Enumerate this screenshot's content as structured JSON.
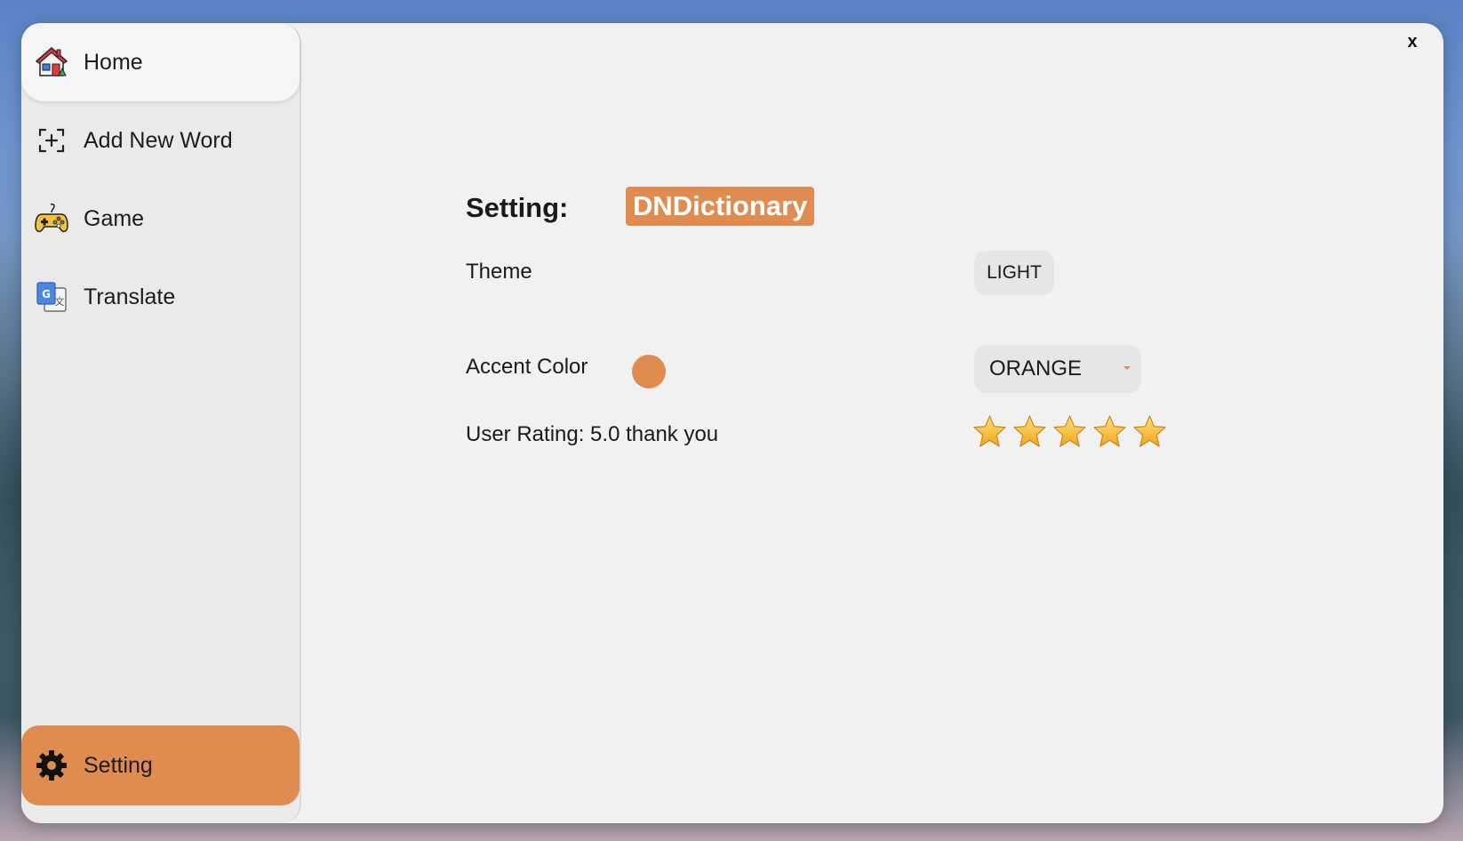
{
  "sidebar": {
    "items": [
      {
        "label": "Home",
        "icon": "home-icon"
      },
      {
        "label": "Add New Word",
        "icon": "add-word-icon"
      },
      {
        "label": "Game",
        "icon": "gamepad-icon"
      },
      {
        "label": "Translate",
        "icon": "translate-icon"
      }
    ],
    "setting": {
      "label": "Setting",
      "icon": "gear-icon"
    }
  },
  "window": {
    "close_label": "x"
  },
  "settings": {
    "title": "Setting:",
    "app_name": "DNDictionary",
    "theme": {
      "label": "Theme",
      "value": "LIGHT"
    },
    "accent": {
      "label": "Accent Color",
      "value": "ORANGE",
      "color": "#e08c50"
    },
    "rating": {
      "label": "User Rating: 5.0 thank you",
      "stars": 5,
      "max_stars": 5
    }
  },
  "colors": {
    "accent": "#e08c50",
    "panel": "#f1f1f1",
    "sidebar": "#eaeaea"
  }
}
